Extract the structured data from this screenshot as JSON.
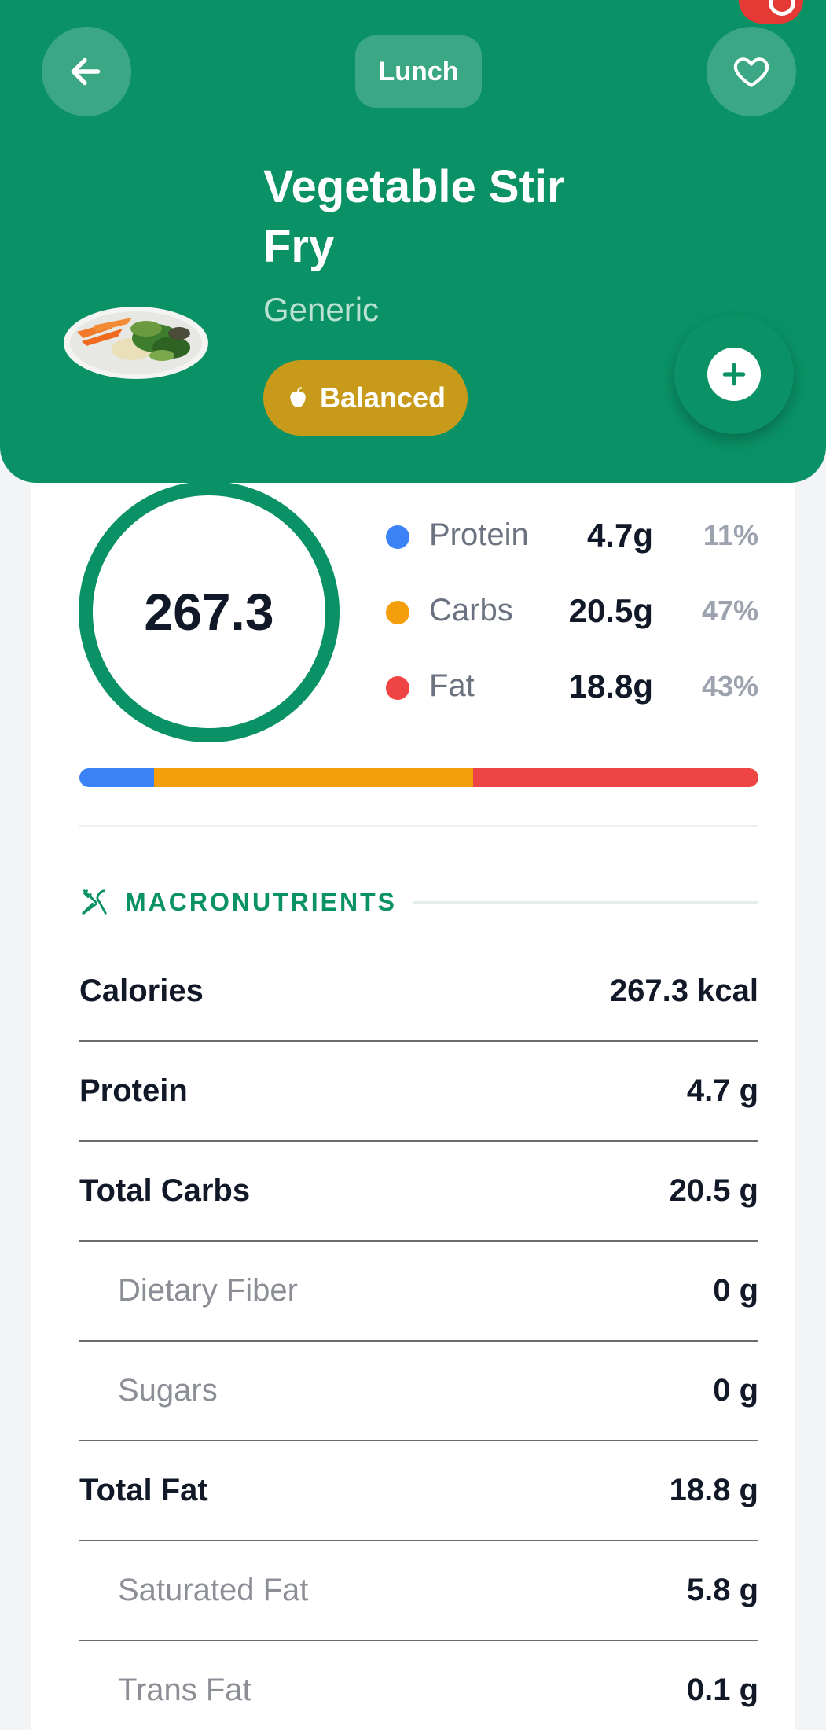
{
  "header": {
    "meal_chip": "Lunch",
    "title": "Vegetable Stir Fry",
    "subtitle": "Generic",
    "badge": "Balanced",
    "bg_color": "#0a9266"
  },
  "summary": {
    "calories": "267.3",
    "macros": [
      {
        "name": "Protein",
        "grams": "4.7g",
        "percent": "11%",
        "color": "#3b82f6",
        "fraction": 0.11
      },
      {
        "name": "Carbs",
        "grams": "20.5g",
        "percent": "47%",
        "color": "#f59e0b",
        "fraction": 0.47
      },
      {
        "name": "Fat",
        "grams": "18.8g",
        "percent": "43%",
        "color": "#ef4444",
        "fraction": 0.42
      }
    ]
  },
  "section": {
    "title": "MACRONUTRIENTS"
  },
  "nutrients": [
    {
      "label": "Calories",
      "value": "267.3 kcal",
      "sub": false
    },
    {
      "label": "Protein",
      "value": "4.7 g",
      "sub": false
    },
    {
      "label": "Total Carbs",
      "value": "20.5 g",
      "sub": false
    },
    {
      "label": "Dietary Fiber",
      "value": "0 g",
      "sub": true
    },
    {
      "label": "Sugars",
      "value": "0 g",
      "sub": true
    },
    {
      "label": "Total Fat",
      "value": "18.8 g",
      "sub": false
    },
    {
      "label": "Saturated Fat",
      "value": "5.8 g",
      "sub": true
    },
    {
      "label": "Trans Fat",
      "value": "0.1 g",
      "sub": true
    }
  ],
  "icons": {
    "back": "arrow-left-icon",
    "favorite": "heart-icon",
    "add": "plus-icon",
    "badge": "apple-icon",
    "section": "utensils-icon"
  }
}
